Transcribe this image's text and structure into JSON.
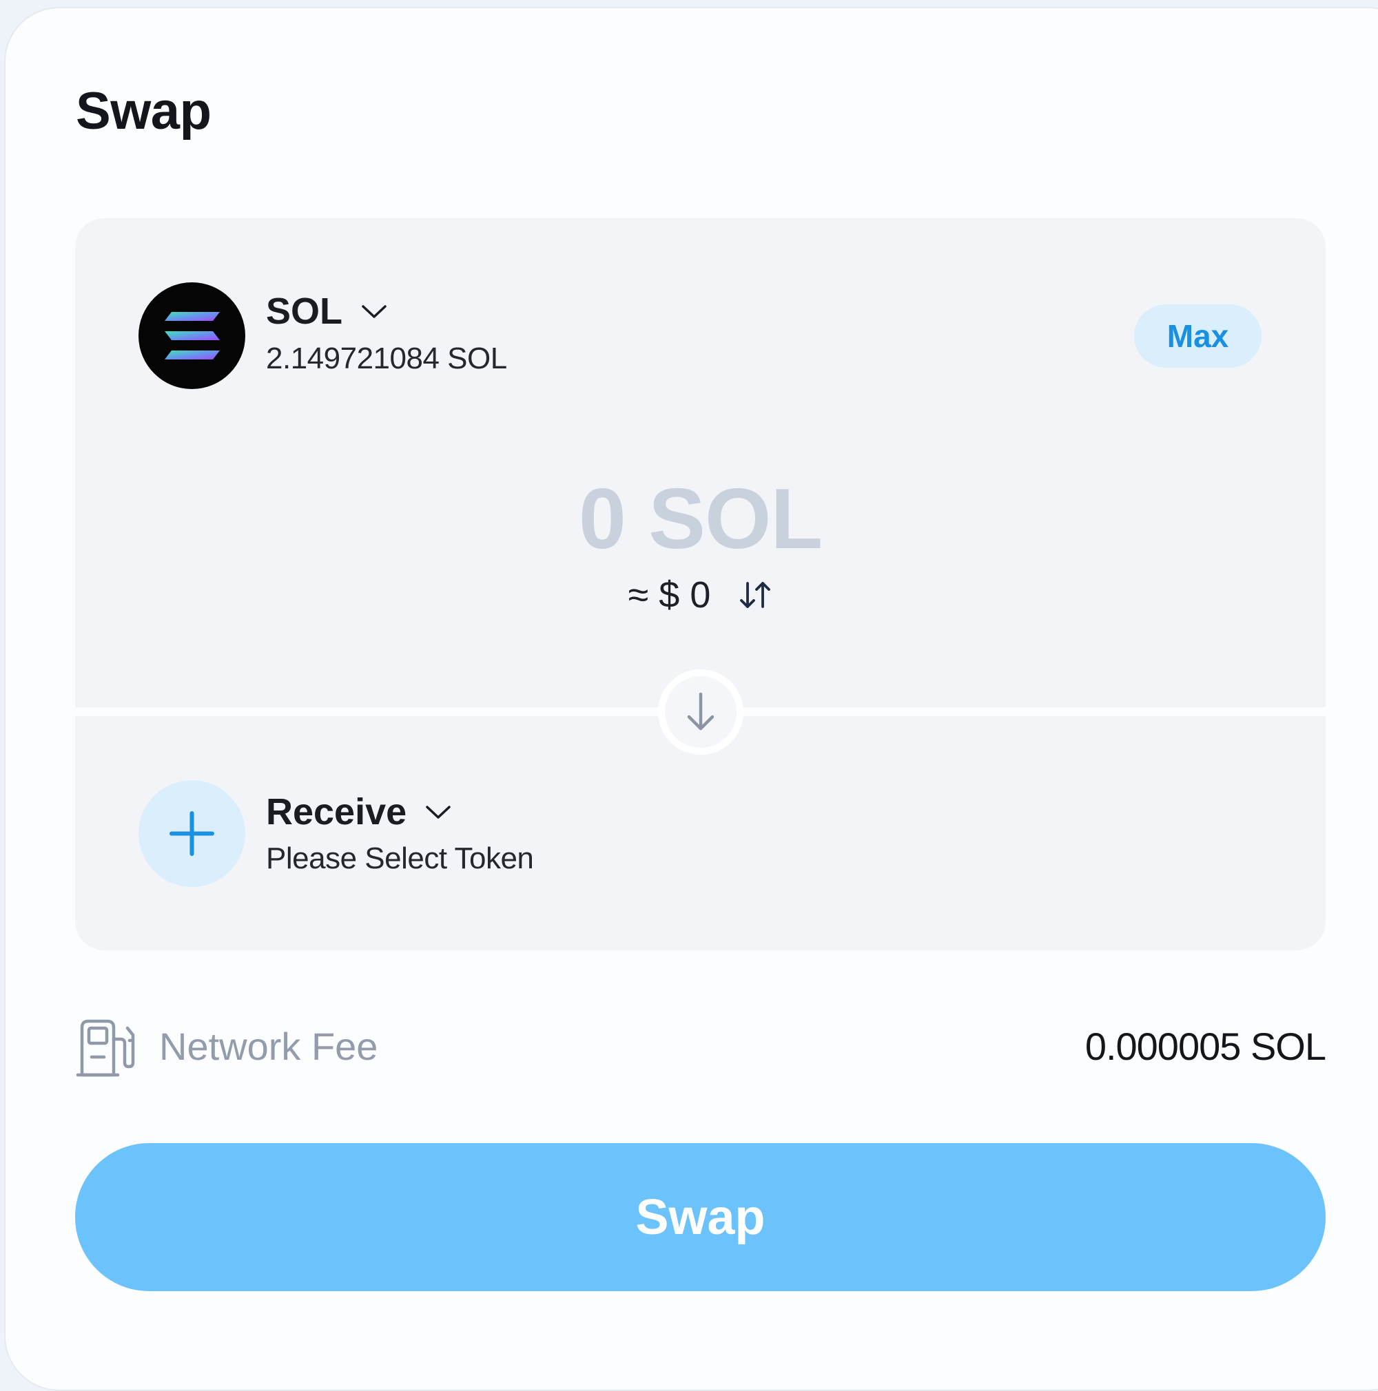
{
  "colors": {
    "accent": "#1a90e3",
    "swap_button": "#6cc2fa",
    "panel_bg": "#f2f4f8",
    "muted_text": "#929cab"
  },
  "header": {
    "title": "Swap"
  },
  "from": {
    "token_icon": "solana-logo-icon",
    "token": "SOL",
    "balance": "2.149721084 SOL",
    "max_label": "Max",
    "amount": "0 SOL",
    "fiat": "≈ $ 0",
    "toggle_icon": "swap-vertical-icon"
  },
  "direction_icon": "arrow-down-icon",
  "to": {
    "icon": "plus-icon",
    "label": "Receive",
    "placeholder": "Please Select Token"
  },
  "fee": {
    "icon": "fuel-pump-icon",
    "label": "Network Fee",
    "value": "0.000005 SOL"
  },
  "action": {
    "swap_label": "Swap"
  }
}
